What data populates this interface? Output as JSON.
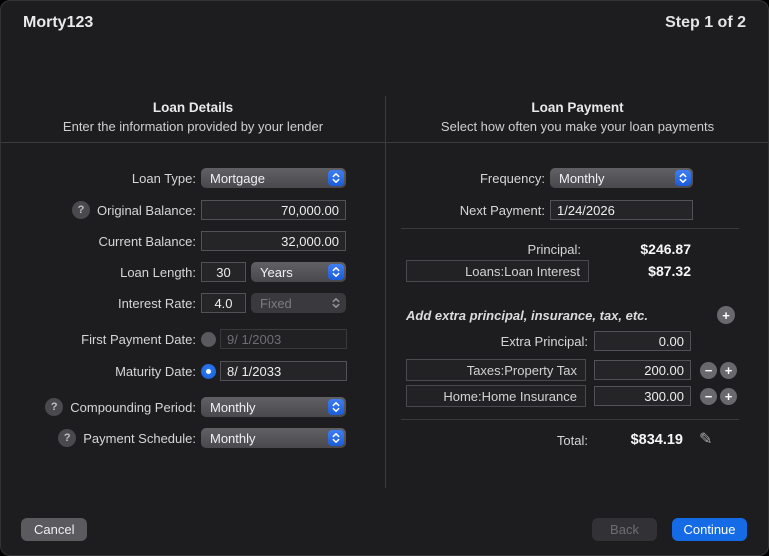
{
  "titlebar": {
    "title": "Morty123",
    "step": "Step 1 of 2"
  },
  "icons": {
    "help": "?",
    "add": "+",
    "remove": "−",
    "edit": "✎"
  },
  "loan_details": {
    "heading": "Loan Details",
    "subheading": "Enter the information provided by your lender",
    "loan_type_label": "Loan Type:",
    "loan_type_value": "Mortgage",
    "original_balance_label": "Original Balance:",
    "original_balance_value": "70,000.00",
    "current_balance_label": "Current Balance:",
    "current_balance_value": "32,000.00",
    "loan_length_label": "Loan Length:",
    "loan_length_value": "30",
    "loan_length_unit": "Years",
    "interest_rate_label": "Interest Rate:",
    "interest_rate_value": "4.0",
    "interest_rate_type": "Fixed",
    "first_payment_label": "First Payment Date:",
    "first_payment_value": "9/ 1/2003",
    "first_payment_selected": false,
    "maturity_label": "Maturity Date:",
    "maturity_value": "8/ 1/2033",
    "maturity_selected": true,
    "compounding_label": "Compounding Period:",
    "compounding_value": "Monthly",
    "schedule_label": "Payment Schedule:",
    "schedule_value": "Monthly"
  },
  "loan_payment": {
    "heading": "Loan Payment",
    "subheading": "Select how often you make your loan payments",
    "frequency_label": "Frequency:",
    "frequency_value": "Monthly",
    "next_payment_label": "Next Payment:",
    "next_payment_value": "1/24/2026",
    "principal_label": "Principal:",
    "principal_value": "$246.87",
    "interest_category": "Loans:Loan Interest",
    "interest_value": "$87.32",
    "extras_hint": "Add extra principal, insurance, tax, etc.",
    "extra_principal_label": "Extra Principal:",
    "extra_principal_value": "0.00",
    "extras": [
      {
        "category": "Taxes:Property Tax",
        "amount": "200.00"
      },
      {
        "category": "Home:Home Insurance",
        "amount": "300.00"
      }
    ],
    "total_label": "Total:",
    "total_value": "$834.19"
  },
  "footer": {
    "cancel": "Cancel",
    "back": "Back",
    "continue": "Continue"
  },
  "colors": {
    "accent_blue": "#156be5",
    "window_bg": "#1d1d1f",
    "divider": "#3b3b3d",
    "field_border": "#525256"
  }
}
